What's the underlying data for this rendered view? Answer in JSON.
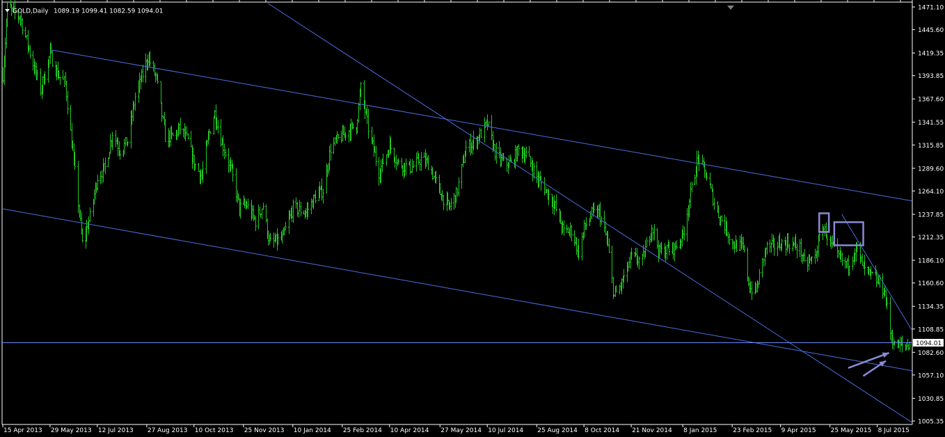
{
  "header": {
    "symbol_text": "GOLD,Daily",
    "ohlc_text": "1089.19 1099.41 1082.59 1094.01"
  },
  "current_price_label": "1094.01",
  "colors": {
    "background": "#000000",
    "candle": "#22c822",
    "trendline": "#4a6fe0",
    "hline": "#6b8cff",
    "marker": "#8a8ad6",
    "axis_text": "#ffffff",
    "price_tag_bg": "#ffffff",
    "price_tag_text": "#000000"
  },
  "icons": {
    "dropdown": "triangle-down-icon",
    "scroll_marker": "triangle-down-icon"
  },
  "chart_data": {
    "type": "candlestick",
    "title": "GOLD,Daily",
    "y_axis_side": "right",
    "ylim": [
      1005.35,
      1471.1
    ],
    "y_ticks": [
      "1471.10",
      "1445.60",
      "1419.35",
      "1393.85",
      "1367.60",
      "1341.55",
      "1315.85",
      "1289.60",
      "1264.10",
      "1237.85",
      "1212.35",
      "1186.10",
      "1160.60",
      "1134.35",
      "1108.85",
      "1082.60",
      "1057.10",
      "1030.85",
      "1005.35"
    ],
    "x_range": [
      "2013-04-15",
      "2015-08-09"
    ],
    "x_ticks": [
      {
        "label": "15 Apr 2013",
        "date": "2013-04-15"
      },
      {
        "label": "29 May 2013",
        "date": "2013-05-29"
      },
      {
        "label": "12 Jul 2013",
        "date": "2013-07-12"
      },
      {
        "label": "27 Aug 2013",
        "date": "2013-08-27"
      },
      {
        "label": "10 Oct 2013",
        "date": "2013-10-10"
      },
      {
        "label": "25 Nov 2013",
        "date": "2013-11-25"
      },
      {
        "label": "10 Jan 2014",
        "date": "2014-01-10"
      },
      {
        "label": "25 Feb 2014",
        "date": "2014-02-25"
      },
      {
        "label": "10 Apr 2014",
        "date": "2014-04-10"
      },
      {
        "label": "27 May 2014",
        "date": "2014-05-27"
      },
      {
        "label": "10 Jul 2014",
        "date": "2014-07-10"
      },
      {
        "label": "25 Aug 2014",
        "date": "2014-08-25"
      },
      {
        "label": "8 Oct 2014",
        "date": "2014-10-08"
      },
      {
        "label": "21 Nov 2014",
        "date": "2014-11-21"
      },
      {
        "label": "8 Jan 2015",
        "date": "2015-01-08"
      },
      {
        "label": "23 Feb 2015",
        "date": "2015-02-23"
      },
      {
        "label": "9 Apr 2015",
        "date": "2015-04-09"
      },
      {
        "label": "25 May 2015",
        "date": "2015-05-25"
      },
      {
        "label": "8 Jul 2015",
        "date": "2015-07-08"
      }
    ],
    "price_path": [
      [
        "2013-04-15",
        1395
      ],
      [
        "2013-04-19",
        1470
      ],
      [
        "2013-05-01",
        1460
      ],
      [
        "2013-05-10",
        1420
      ],
      [
        "2013-05-20",
        1378
      ],
      [
        "2013-05-29",
        1418
      ],
      [
        "2013-06-05",
        1395
      ],
      [
        "2013-06-12",
        1385
      ],
      [
        "2013-06-21",
        1285
      ],
      [
        "2013-06-28",
        1205
      ],
      [
        "2013-07-05",
        1235
      ],
      [
        "2013-07-12",
        1280
      ],
      [
        "2013-07-19",
        1290
      ],
      [
        "2013-07-26",
        1330
      ],
      [
        "2013-08-02",
        1310
      ],
      [
        "2013-08-09",
        1320
      ],
      [
        "2013-08-16",
        1370
      ],
      [
        "2013-08-23",
        1395
      ],
      [
        "2013-08-28",
        1415
      ],
      [
        "2013-09-05",
        1390
      ],
      [
        "2013-09-13",
        1325
      ],
      [
        "2013-09-20",
        1325
      ],
      [
        "2013-09-27",
        1335
      ],
      [
        "2013-10-04",
        1320
      ],
      [
        "2013-10-10",
        1295
      ],
      [
        "2013-10-17",
        1280
      ],
      [
        "2013-10-24",
        1330
      ],
      [
        "2013-10-29",
        1352
      ],
      [
        "2013-11-05",
        1318
      ],
      [
        "2013-11-14",
        1285
      ],
      [
        "2013-11-21",
        1245
      ],
      [
        "2013-11-28",
        1248
      ],
      [
        "2013-12-06",
        1230
      ],
      [
        "2013-12-13",
        1248
      ],
      [
        "2013-12-19",
        1205
      ],
      [
        "2013-12-31",
        1210
      ],
      [
        "2014-01-10",
        1245
      ],
      [
        "2014-01-22",
        1240
      ],
      [
        "2014-01-31",
        1258
      ],
      [
        "2014-02-07",
        1265
      ],
      [
        "2014-02-14",
        1312
      ],
      [
        "2014-02-21",
        1322
      ],
      [
        "2014-02-28",
        1330
      ],
      [
        "2014-03-10",
        1338
      ],
      [
        "2014-03-14",
        1380
      ],
      [
        "2014-03-21",
        1335
      ],
      [
        "2014-03-31",
        1285
      ],
      [
        "2014-04-10",
        1315
      ],
      [
        "2014-04-18",
        1295
      ],
      [
        "2014-04-30",
        1290
      ],
      [
        "2014-05-09",
        1300
      ],
      [
        "2014-05-16",
        1295
      ],
      [
        "2014-05-27",
        1262
      ],
      [
        "2014-06-04",
        1245
      ],
      [
        "2014-06-11",
        1260
      ],
      [
        "2014-06-20",
        1312
      ],
      [
        "2014-06-30",
        1322
      ],
      [
        "2014-07-10",
        1340
      ],
      [
        "2014-07-17",
        1308
      ],
      [
        "2014-07-25",
        1295
      ],
      [
        "2014-08-01",
        1295
      ],
      [
        "2014-08-08",
        1310
      ],
      [
        "2014-08-15",
        1305
      ],
      [
        "2014-08-25",
        1280
      ],
      [
        "2014-09-02",
        1265
      ],
      [
        "2014-09-10",
        1250
      ],
      [
        "2014-09-19",
        1218
      ],
      [
        "2014-09-26",
        1220
      ],
      [
        "2014-10-03",
        1195
      ],
      [
        "2014-10-08",
        1222
      ],
      [
        "2014-10-15",
        1238
      ],
      [
        "2014-10-22",
        1240
      ],
      [
        "2014-10-29",
        1210
      ],
      [
        "2014-11-05",
        1145
      ],
      [
        "2014-11-12",
        1160
      ],
      [
        "2014-11-21",
        1190
      ],
      [
        "2014-12-01",
        1185
      ],
      [
        "2014-12-10",
        1225
      ],
      [
        "2014-12-17",
        1195
      ],
      [
        "2014-12-31",
        1200
      ],
      [
        "2015-01-08",
        1215
      ],
      [
        "2015-01-15",
        1260
      ],
      [
        "2015-01-22",
        1302
      ],
      [
        "2015-01-30",
        1280
      ],
      [
        "2015-02-09",
        1240
      ],
      [
        "2015-02-16",
        1225
      ],
      [
        "2015-02-23",
        1205
      ],
      [
        "2015-03-05",
        1200
      ],
      [
        "2015-03-11",
        1155
      ],
      [
        "2015-03-17",
        1152
      ],
      [
        "2015-03-26",
        1200
      ],
      [
        "2015-04-02",
        1202
      ],
      [
        "2015-04-09",
        1205
      ],
      [
        "2015-04-17",
        1205
      ],
      [
        "2015-04-27",
        1200
      ],
      [
        "2015-05-01",
        1180
      ],
      [
        "2015-05-11",
        1190
      ],
      [
        "2015-05-18",
        1225
      ],
      [
        "2015-05-25",
        1205
      ],
      [
        "2015-06-01",
        1190
      ],
      [
        "2015-06-10",
        1180
      ],
      [
        "2015-06-18",
        1200
      ],
      [
        "2015-06-26",
        1175
      ],
      [
        "2015-07-03",
        1168
      ],
      [
        "2015-07-10",
        1160
      ],
      [
        "2015-07-15",
        1150
      ],
      [
        "2015-07-20",
        1105
      ],
      [
        "2015-07-24",
        1090
      ],
      [
        "2015-08-03",
        1090
      ],
      [
        "2015-08-09",
        1094
      ]
    ],
    "trendlines": [
      {
        "from": [
          "2013-05-29",
          1423
        ],
        "to": [
          "2015-08-09",
          1253
        ]
      },
      {
        "from": [
          "2013-04-15",
          1244
        ],
        "to": [
          "2015-08-09",
          1062
        ]
      },
      {
        "from": [
          "2013-12-18",
          1475
        ],
        "to": [
          "2015-08-09",
          1004
        ]
      },
      {
        "from": [
          "2015-06-05",
          1238
        ],
        "to": [
          "2015-08-09",
          1108
        ]
      }
    ],
    "horizontal_line": 1094.01,
    "annotations": [
      {
        "type": "rect",
        "from": [
          "2015-05-15",
          1239
        ],
        "to": [
          "2015-05-24",
          1218
        ]
      },
      {
        "type": "rect",
        "from": [
          "2015-05-29",
          1229
        ],
        "to": [
          "2015-06-25",
          1203
        ]
      },
      {
        "type": "arrow",
        "from": [
          "2015-06-11",
          1065
        ],
        "to": [
          "2015-07-19",
          1082
        ]
      },
      {
        "type": "arrow",
        "from": [
          "2015-06-25",
          1056
        ],
        "to": [
          "2015-07-16",
          1073
        ]
      }
    ]
  }
}
